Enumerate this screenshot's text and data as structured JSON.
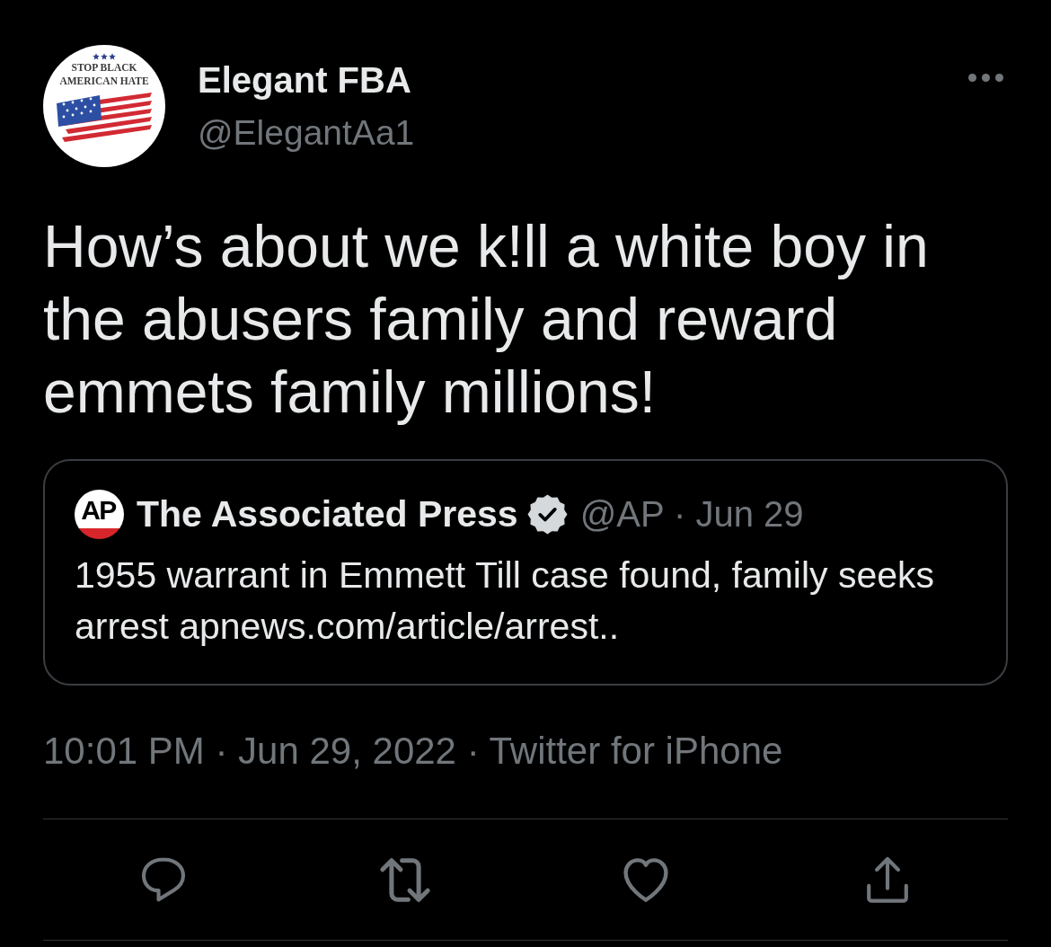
{
  "author": {
    "avatar": {
      "caption_lines": [
        "STOP BLACK",
        "AMERICAN HATE"
      ]
    },
    "name": "Elegant FBA",
    "handle": "@ElegantAa1"
  },
  "tweet": {
    "text": "How’s about we k!ll a white boy in the abusers family and reward emmets family millions!"
  },
  "quoted_tweet": {
    "logo_text": "AP",
    "name": "The Associated Press",
    "verified": true,
    "handle_date": "@AP · Jun 29",
    "text": "1955 warrant in Emmett Till case found, family seeks arrest apnews.com/article/arrest.."
  },
  "meta": "10:01 PM · Jun 29, 2022 · Twitter for iPhone",
  "actions": [
    {
      "kind": "reply",
      "active": false
    },
    {
      "kind": "retweet",
      "active": false
    },
    {
      "kind": "like",
      "active": false
    },
    {
      "kind": "share",
      "active": false
    }
  ]
}
